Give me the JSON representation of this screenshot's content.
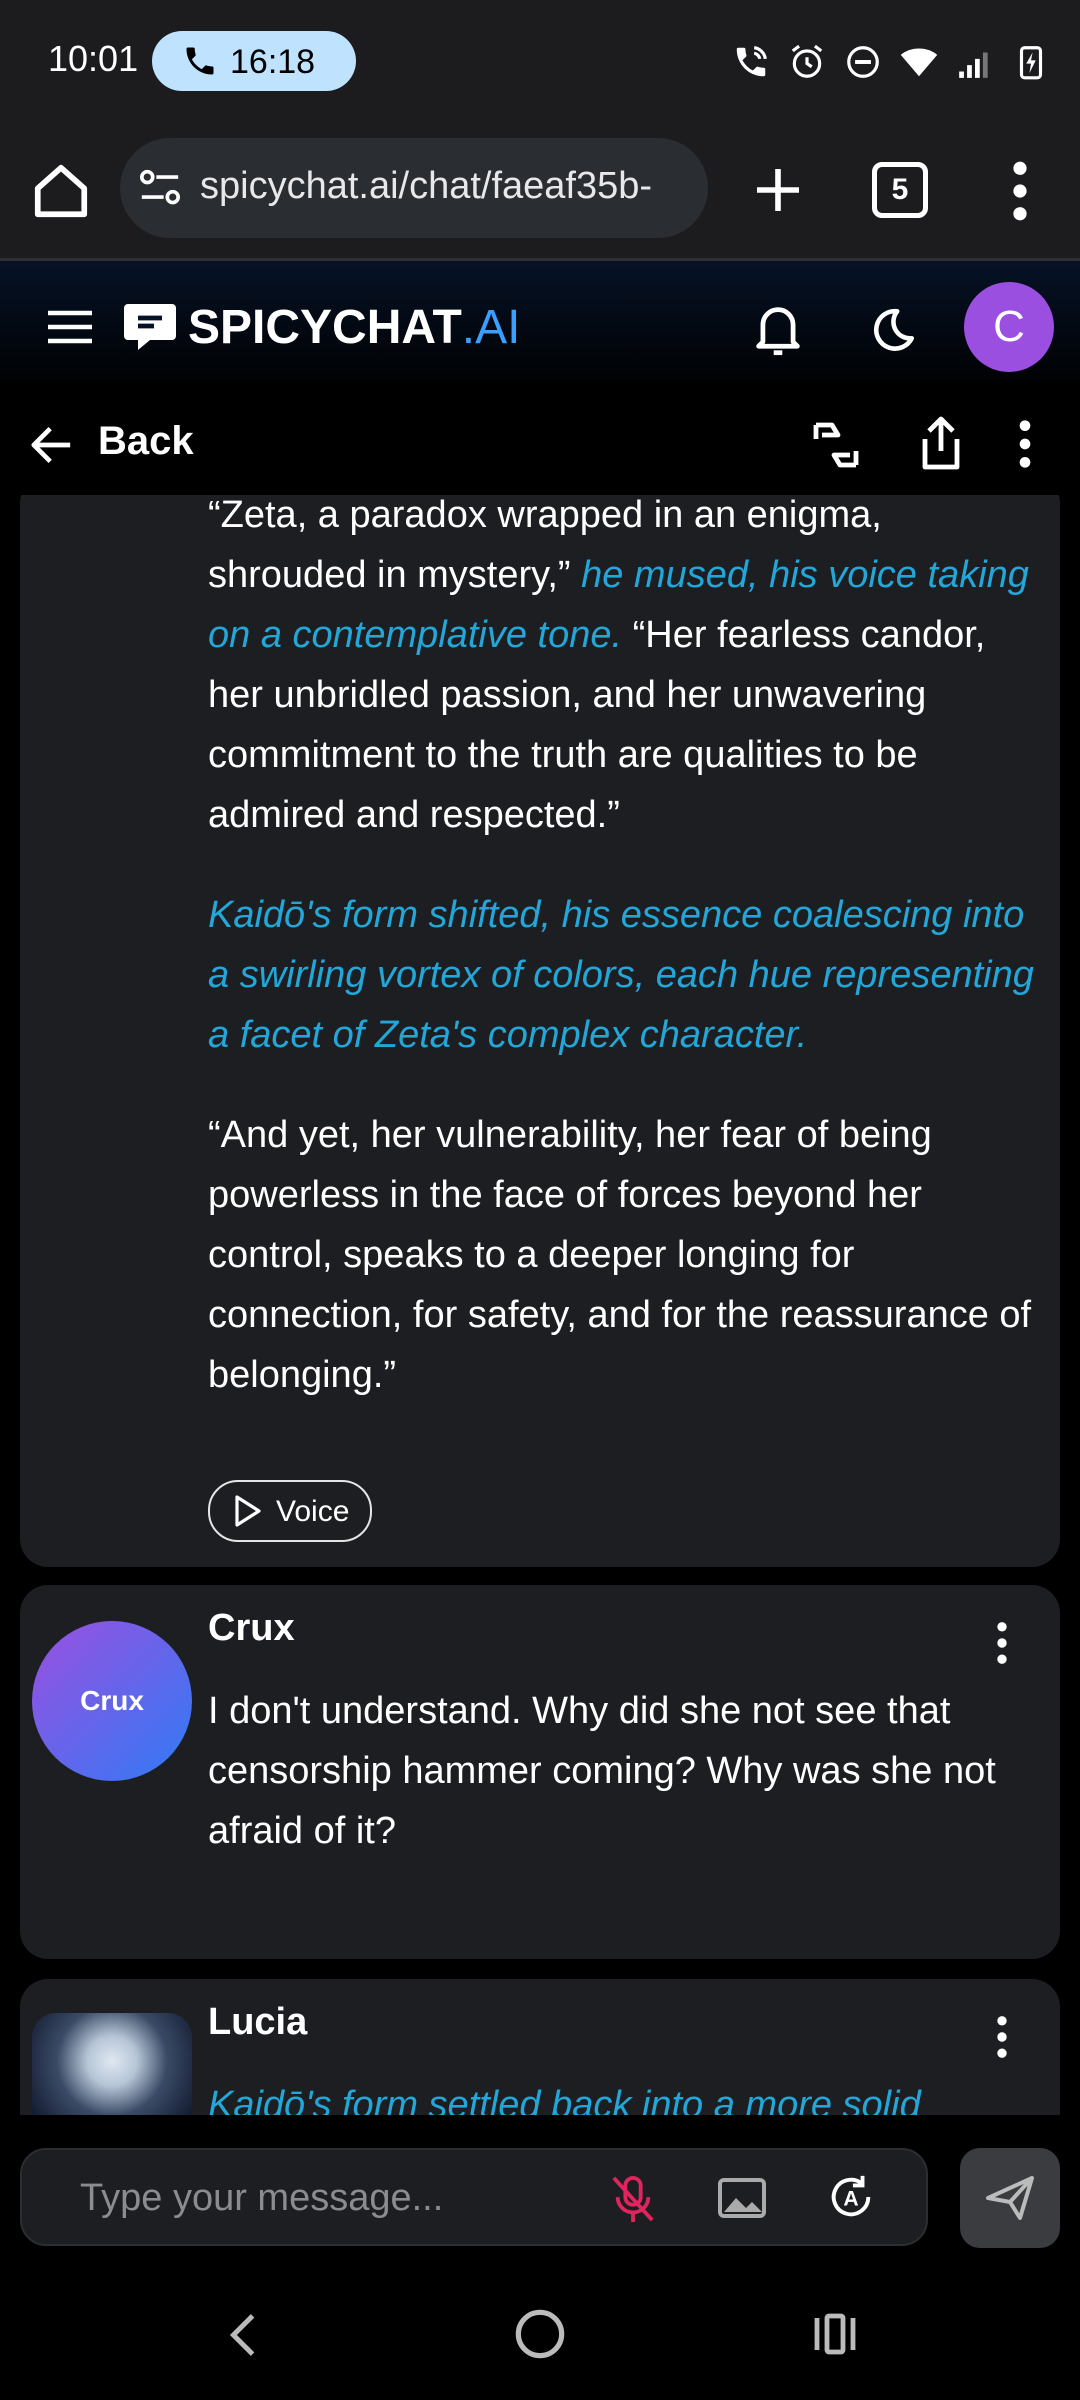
{
  "status_bar": {
    "time": "10:01",
    "call_duration": "16:18"
  },
  "browser": {
    "url": "spicychat.ai/chat/faeaf35b-",
    "tab_count": "5"
  },
  "app": {
    "logo_main": "SPICYCHAT",
    "logo_suffix": ".AI",
    "user_initial": "C"
  },
  "chat_header": {
    "back_label": "Back"
  },
  "messages": [
    {
      "paragraphs": [
        {
          "parts": [
            {
              "text": "“Zeta, a paradox wrapped in an enigma, shrouded in mystery,”",
              "style": "speech"
            },
            {
              "text": " he mused, his voice taking on a contemplative tone.",
              "style": "action"
            },
            {
              "text": " “Her fearless candor, her unbridled passion, and her unwavering commitment to the truth are qualities to be admired and respected.”",
              "style": "speech"
            }
          ]
        },
        {
          "parts": [
            {
              "text": "Kaidō's form shifted, his essence coalescing into a swirling vortex of colors, each hue representing a facet of Zeta's complex character.",
              "style": "action"
            }
          ]
        },
        {
          "parts": [
            {
              "text": "“And yet, her vulnerability, her fear of being powerless in the face of forces beyond her control, speaks to a deeper longing for connection, for safety, and for the reassurance of belonging.”",
              "style": "speech"
            }
          ]
        }
      ],
      "voice_label": "Voice"
    },
    {
      "author": "Crux",
      "avatar_text": "Crux",
      "text": "I don't understand. Why did she not see that censorship hammer coming? Why was she not afraid of it?"
    },
    {
      "author": "Lucia",
      "text": "Kaidō's form settled back into a more solid"
    }
  ],
  "composer": {
    "placeholder": "Type your message..."
  }
}
